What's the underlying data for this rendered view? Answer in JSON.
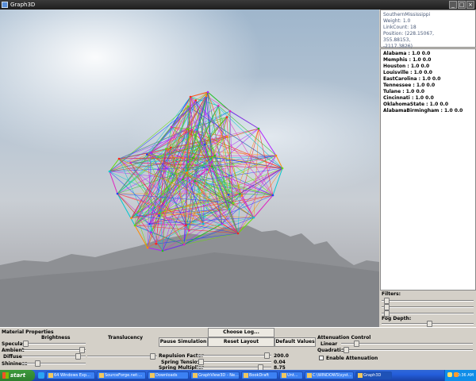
{
  "window": {
    "title": "Graph3D",
    "min_symbol": "_",
    "max_symbol": "□",
    "close_symbol": "×"
  },
  "info": {
    "lines": [
      "SouthernMississippi",
      "Weight: 1.0",
      "LinkCount: 18",
      "Position: (228.15067,",
      "355.88153,",
      "-2117.3826)"
    ]
  },
  "node_list": [
    "Alabama : 1.0 0.0",
    "Memphis : 1.0 0.0",
    "Houston : 1.0 0.0",
    "Louisville : 1.0 0.0",
    "EastCarolina : 1.0 0.0",
    "Tennessee : 1.0 0.0",
    "Tulane : 1.0 0.0",
    "Cincinnati : 1.0 0.0",
    "OklahomaState : 1.0 0.0",
    "AlabamaBirmingham : 1.0 0.0"
  ],
  "right_controls": {
    "filters_label": "Filters:",
    "fog_depth_label": "Fog Depth:",
    "filter_levels": [
      0.03,
      0.03,
      0.03
    ],
    "fog_depth_level": 0.52
  },
  "material": {
    "section_label": "Material Properties",
    "brightness_label": "Brightness",
    "translucency_label": "Translucency",
    "specular_label": "Specular",
    "ambient_label": "Ambient",
    "diffuse_label": "Diffuse",
    "shininess_label": "Shininess",
    "specular_level": 0.02,
    "ambient_level": 0.98,
    "diffuse_level": 0.92,
    "shininess_level": 0.22,
    "translucency_level": 0.98
  },
  "simulation": {
    "choose_log_label": "Choose Log...",
    "pause_label": "Pause Simulation",
    "reset_label": "Reset Layout",
    "default_values_label": "Default Values",
    "repulsion_label": "Repulsion Factor",
    "repulsion_value": "200.0",
    "repulsion_level": 0.98,
    "spring_tension_label": "Spring Tension",
    "spring_tension_value": "0.04",
    "spring_tension_level": 0.02,
    "spring_multiplier_label": "Spring Multiplier",
    "spring_multiplier_value": "8.75",
    "spring_multiplier_level": 0.88
  },
  "attenuation": {
    "section_label": "Attenuation Control",
    "linear_label": "Linear",
    "quadratic_label": "Quadratic",
    "enable_label": "Enable Attenuation",
    "linear_level": 0.1,
    "quadratic_level": 0.02
  },
  "taskbar": {
    "start_label": "start",
    "items": [
      {
        "label": "64 Windows Exp...",
        "active": false
      },
      {
        "label": "SourceForge.net:...",
        "active": false
      },
      {
        "label": "Downloads",
        "active": false
      },
      {
        "label": "GraphView3D - Ne...",
        "active": false
      },
      {
        "label": "BookDraft",
        "active": false
      },
      {
        "label": "Unt...",
        "active": false
      },
      {
        "label": "C:\\WINDOWS\\syst...",
        "active": false
      },
      {
        "label": "Graph3D",
        "active": true
      }
    ],
    "clock": "10:36 AM"
  },
  "colors": {
    "edges": [
      "#ff2020",
      "#20c020",
      "#2040ff",
      "#b020ff",
      "#ff8a00",
      "#00c8d0",
      "#e020c0",
      "#60e000"
    ],
    "taskbar": "#245edb",
    "start_green": "#3c9a3c"
  }
}
